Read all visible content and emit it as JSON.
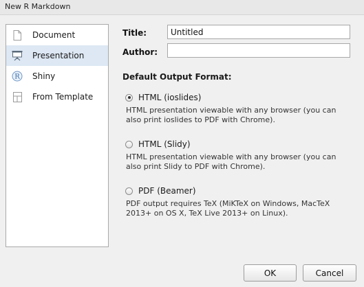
{
  "window": {
    "title": "New R Markdown"
  },
  "sidebar": {
    "items": [
      {
        "label": "Document",
        "icon": "document-icon",
        "selected": false
      },
      {
        "label": "Presentation",
        "icon": "presentation-icon",
        "selected": true
      },
      {
        "label": "Shiny",
        "icon": "shiny-r-icon",
        "selected": false
      },
      {
        "label": "From Template",
        "icon": "template-icon",
        "selected": false
      }
    ],
    "selected_bg": "#dde8f4"
  },
  "form": {
    "title_label": "Title:",
    "title_value": "Untitled",
    "author_label": "Author:",
    "author_value": ""
  },
  "output": {
    "heading": "Default Output Format:",
    "options": [
      {
        "label": "HTML (ioslides)",
        "checked": true,
        "desc1": "HTML presentation viewable with any browser (you can",
        "desc2": "also print ioslides to PDF with Chrome)."
      },
      {
        "label": "HTML (Slidy)",
        "checked": false,
        "desc1": "HTML presentation viewable with any browser (you can",
        "desc2": "also print Slidy to PDF with Chrome)."
      },
      {
        "label": "PDF (Beamer)",
        "checked": false,
        "desc1": "PDF output requires TeX (MiKTeX on Windows, MacTeX",
        "desc2": "2013+ on OS X, TeX Live 2013+ on Linux)."
      }
    ]
  },
  "buttons": {
    "ok": "OK",
    "cancel": "Cancel"
  }
}
